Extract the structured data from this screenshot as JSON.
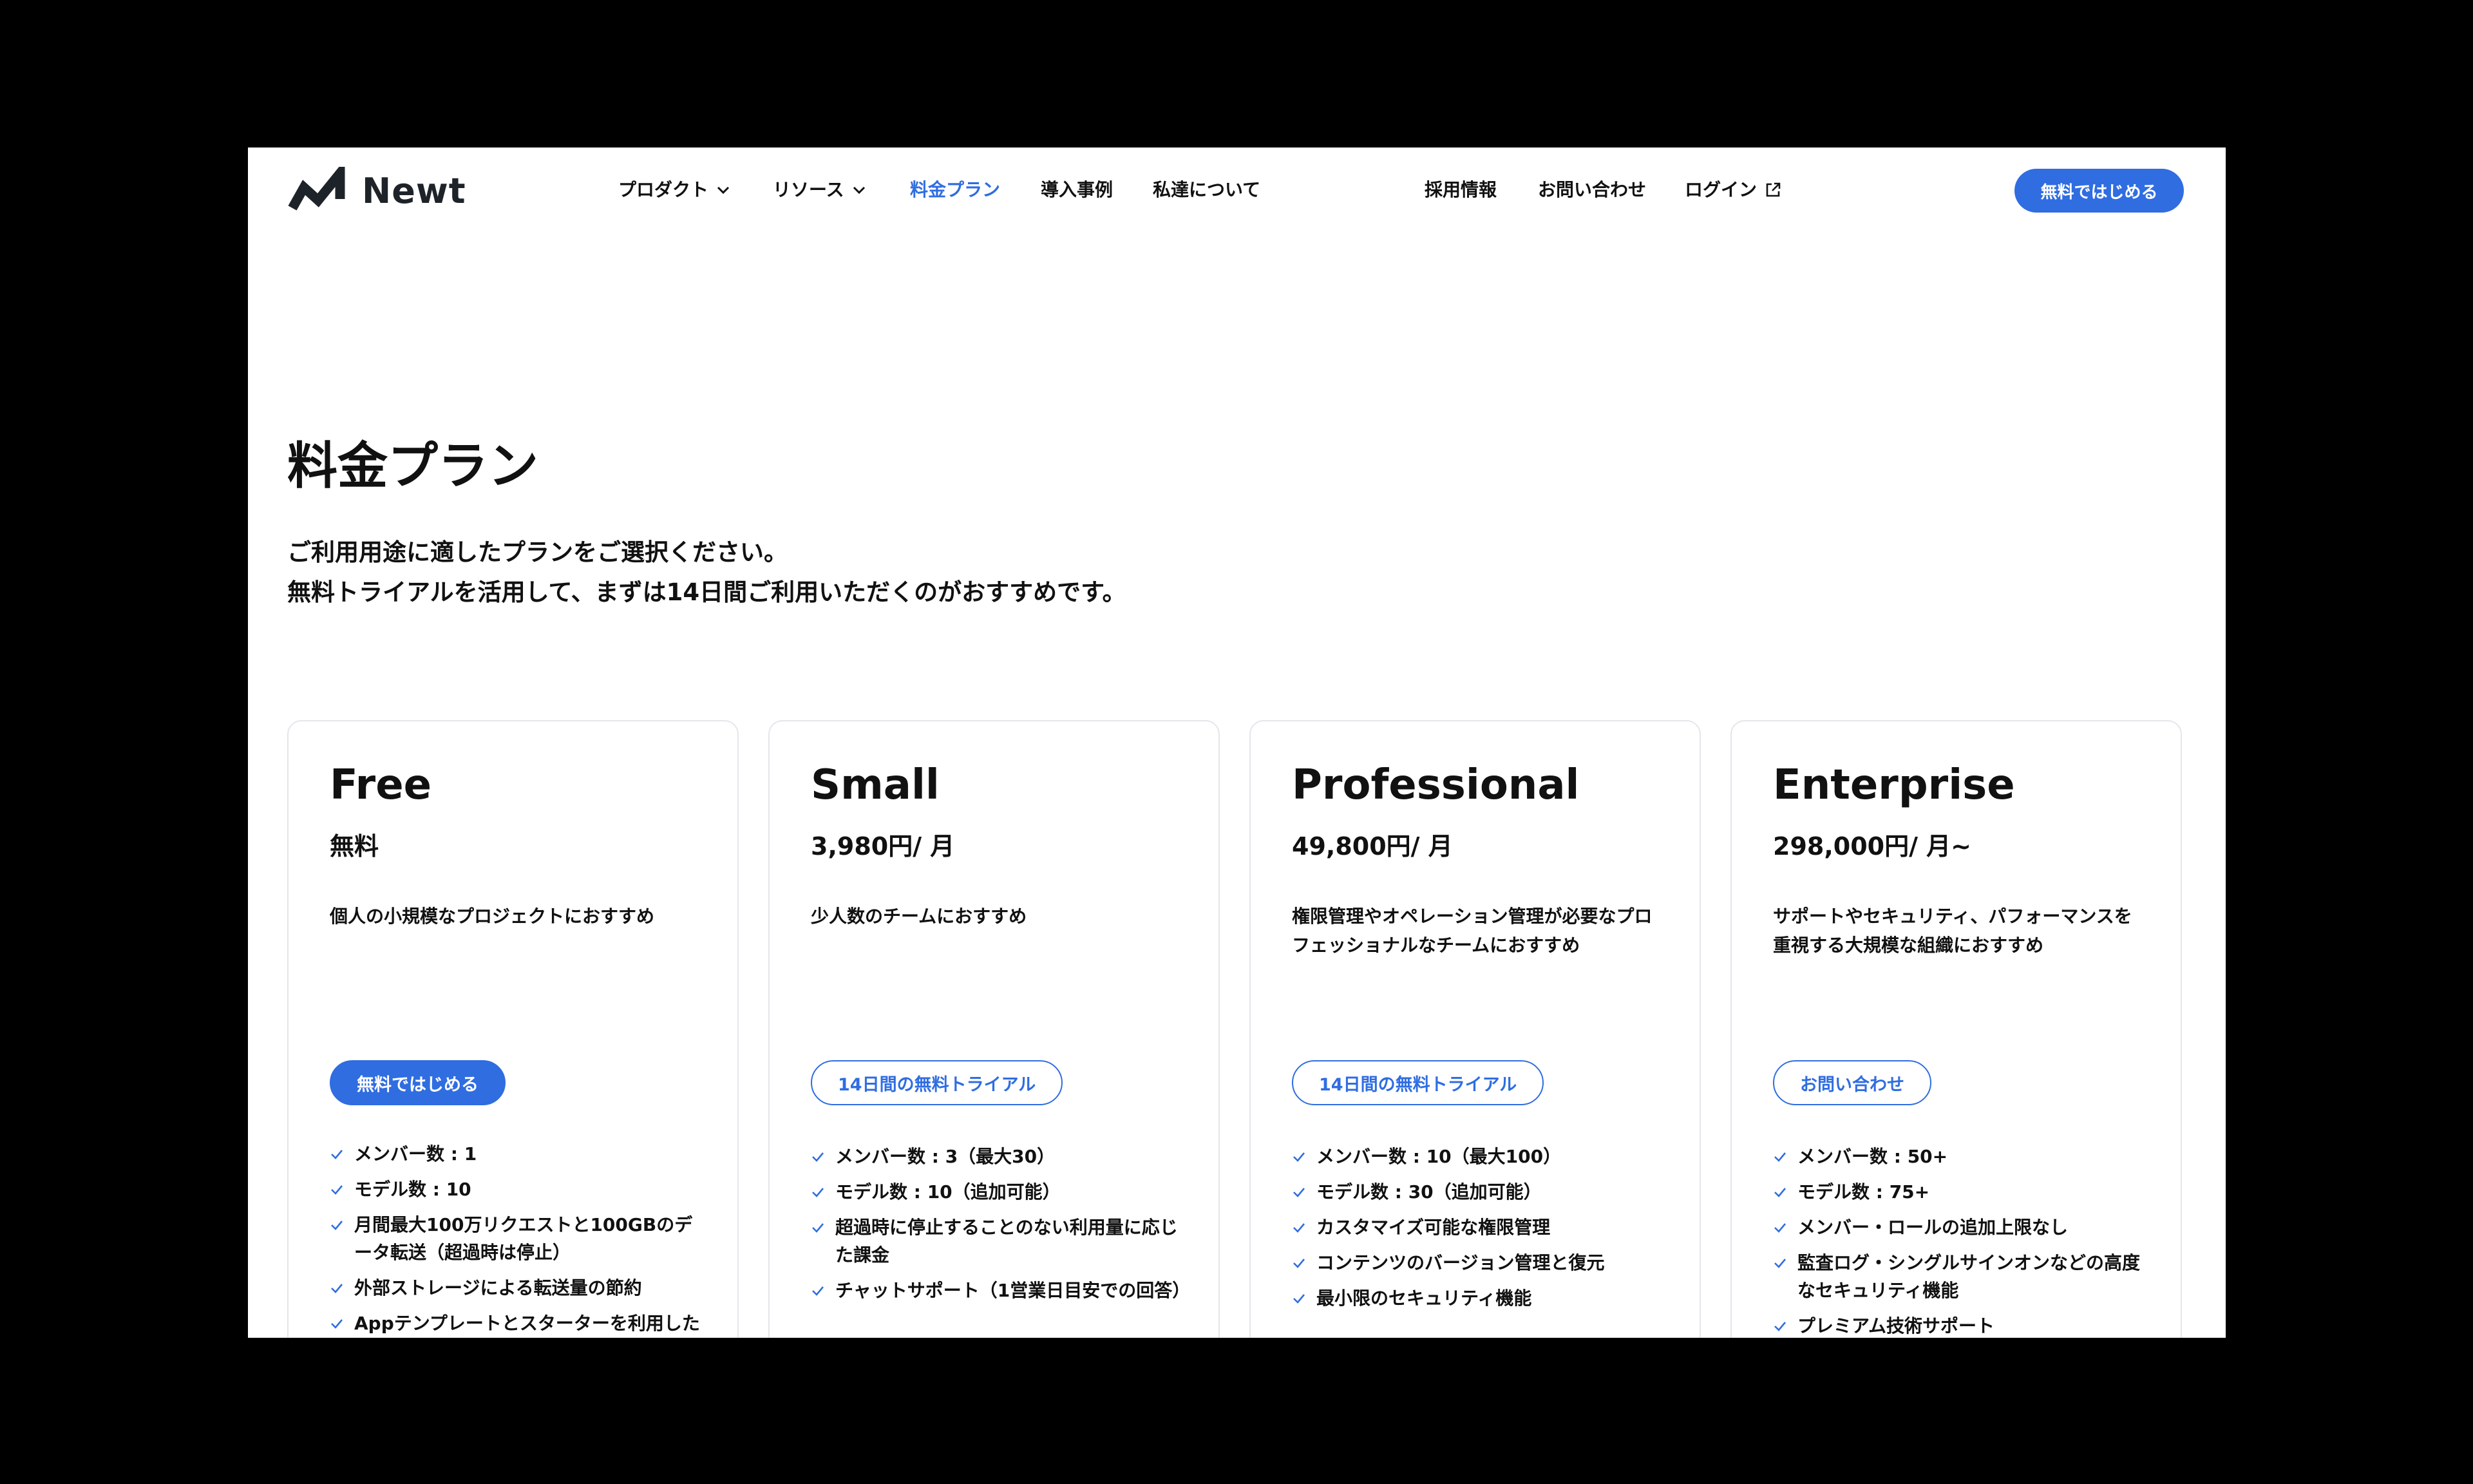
{
  "colors": {
    "accent": "#2f6de1",
    "text": "#111111",
    "card_border": "#e4e6ea"
  },
  "header": {
    "logo_text": "Newt",
    "nav": [
      {
        "label": "プロダクト",
        "has_dropdown": true
      },
      {
        "label": "リソース",
        "has_dropdown": true
      },
      {
        "label": "料金プラン",
        "active": true
      },
      {
        "label": "導入事例"
      },
      {
        "label": "私達について"
      }
    ],
    "right_nav": [
      {
        "label": "採用情報"
      },
      {
        "label": "お問い合わせ"
      },
      {
        "label": "ログイン",
        "icon": "external-link-icon"
      }
    ],
    "cta_label": "無料ではじめる"
  },
  "hero": {
    "title": "料金プラン",
    "intro_lines": [
      "ご利用用途に適したプランをご選択ください。",
      "無料トライアルを活用して、まずは14日間ご利用いただくのがおすすめです。"
    ]
  },
  "plans": [
    {
      "name": "Free",
      "price": "無料",
      "description": "個人の小規模なプロジェクトにおすすめ",
      "cta": {
        "label": "無料ではじめる",
        "style": "solid"
      },
      "features": [
        "メンバー数 : 1",
        "モデル数 : 10",
        "月間最大100万リクエストと100GBのデータ転送（超過時は停止）",
        "外部ストレージによる転送量の節約",
        "Appテンプレートとスターターを利用した"
      ]
    },
    {
      "name": "Small",
      "price": "3,980円/ 月",
      "description": "少人数のチームにおすすめ",
      "cta": {
        "label": "14日間の無料トライアル",
        "style": "outline"
      },
      "features": [
        "メンバー数 : 3（最大30）",
        "モデル数 : 10（追加可能）",
        "超過時に停止することのない利用量に応じた課金",
        "チャットサポート（1営業日目安での回答）"
      ]
    },
    {
      "name": "Professional",
      "price": "49,800円/ 月",
      "description": "権限管理やオペレーション管理が必要なプロフェッショナルなチームにおすすめ",
      "cta": {
        "label": "14日間の無料トライアル",
        "style": "outline"
      },
      "features": [
        "メンバー数 : 10（最大100）",
        "モデル数 : 30（追加可能）",
        "カスタマイズ可能な権限管理",
        "コンテンツのバージョン管理と復元",
        "最小限のセキュリティ機能"
      ]
    },
    {
      "name": "Enterprise",
      "price": "298,000円/ 月~",
      "description": "サポートやセキュリティ、パフォーマンスを重視する大規模な組織におすすめ",
      "cta": {
        "label": "お問い合わせ",
        "style": "outline"
      },
      "features": [
        "メンバー数 : 50+",
        "モデル数 : 75+",
        "メンバー・ロールの追加上限なし",
        "監査ログ・シングルサインオンなどの高度なセキュリティ機能",
        "プレミアム技術サポート"
      ]
    }
  ]
}
